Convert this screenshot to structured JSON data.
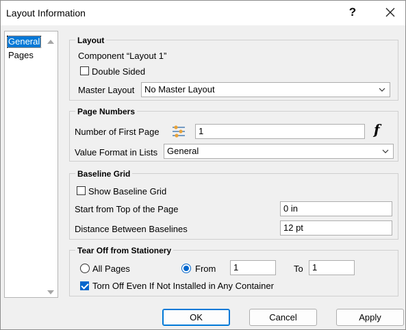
{
  "window": {
    "title": "Layout Information",
    "help_label": "?"
  },
  "nav": {
    "items": [
      {
        "label": "General",
        "selected": true
      },
      {
        "label": "Pages",
        "selected": false
      }
    ]
  },
  "layout_group": {
    "title": "Layout",
    "component_text": "Component “Layout 1”",
    "double_sided_label": "Double Sided",
    "double_sided_checked": false,
    "master_layout_label": "Master Layout",
    "master_layout_value": "No Master Layout"
  },
  "page_numbers": {
    "title": "Page Numbers",
    "first_page_label": "Number of First Page",
    "first_page_value": "1",
    "function_icon": "f",
    "value_format_label": "Value Format in Lists",
    "value_format_value": "General"
  },
  "baseline_grid": {
    "title": "Baseline Grid",
    "show_label": "Show Baseline Grid",
    "show_checked": false,
    "start_label": "Start from Top of the Page",
    "start_value": "0 in",
    "distance_label": "Distance Between Baselines",
    "distance_value": "12 pt"
  },
  "tear_off": {
    "title": "Tear Off from Stationery",
    "all_pages_label": "All Pages",
    "from_label": "From",
    "from_value": "1",
    "to_label": "To",
    "to_value": "1",
    "selected_option": "from",
    "torn_off_label": "Torn Off Even If Not Installed in Any Container",
    "torn_off_checked": true
  },
  "buttons": {
    "ok": "OK",
    "cancel": "Cancel",
    "apply": "Apply"
  },
  "colors": {
    "accent": "#0078d7",
    "checkbox_fill": "#0066cc"
  }
}
